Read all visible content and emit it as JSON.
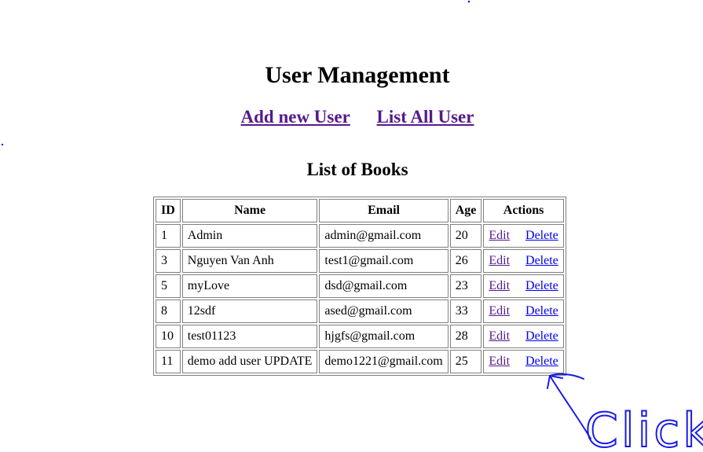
{
  "page": {
    "title": "User Management"
  },
  "nav": {
    "add_label": "Add new User",
    "list_label": "List All User"
  },
  "table": {
    "caption": "List of Books",
    "columns": [
      "ID",
      "Name",
      "Email",
      "Age",
      "Actions"
    ],
    "rows": [
      {
        "id": "1",
        "name": "Admin",
        "email": "admin@gmail.com",
        "age": "20",
        "edit": "Edit",
        "delete": "Delete"
      },
      {
        "id": "3",
        "name": "Nguyen Van Anh",
        "email": "test1@gmail.com",
        "age": "26",
        "edit": "Edit",
        "delete": "Delete"
      },
      {
        "id": "5",
        "name": "myLove",
        "email": "dsd@gmail.com",
        "age": "23",
        "edit": "Edit",
        "delete": "Delete"
      },
      {
        "id": "8",
        "name": "12sdf",
        "email": "ased@gmail.com",
        "age": "33",
        "edit": "Edit",
        "delete": "Delete"
      },
      {
        "id": "10",
        "name": "test01123",
        "email": "hjgfs@gmail.com",
        "age": "28",
        "edit": "Edit",
        "delete": "Delete"
      },
      {
        "id": "11",
        "name": "demo add user UPDATE",
        "email": "demo1221@gmail.com",
        "age": "25",
        "edit": "Edit",
        "delete": "Delete"
      }
    ]
  },
  "annotation": {
    "text": "Click",
    "color": "#1a1ae6"
  },
  "colors": {
    "visited_link": "#551a8b",
    "link": "#0000ee",
    "annotation_ink": "#1a1ae6"
  }
}
